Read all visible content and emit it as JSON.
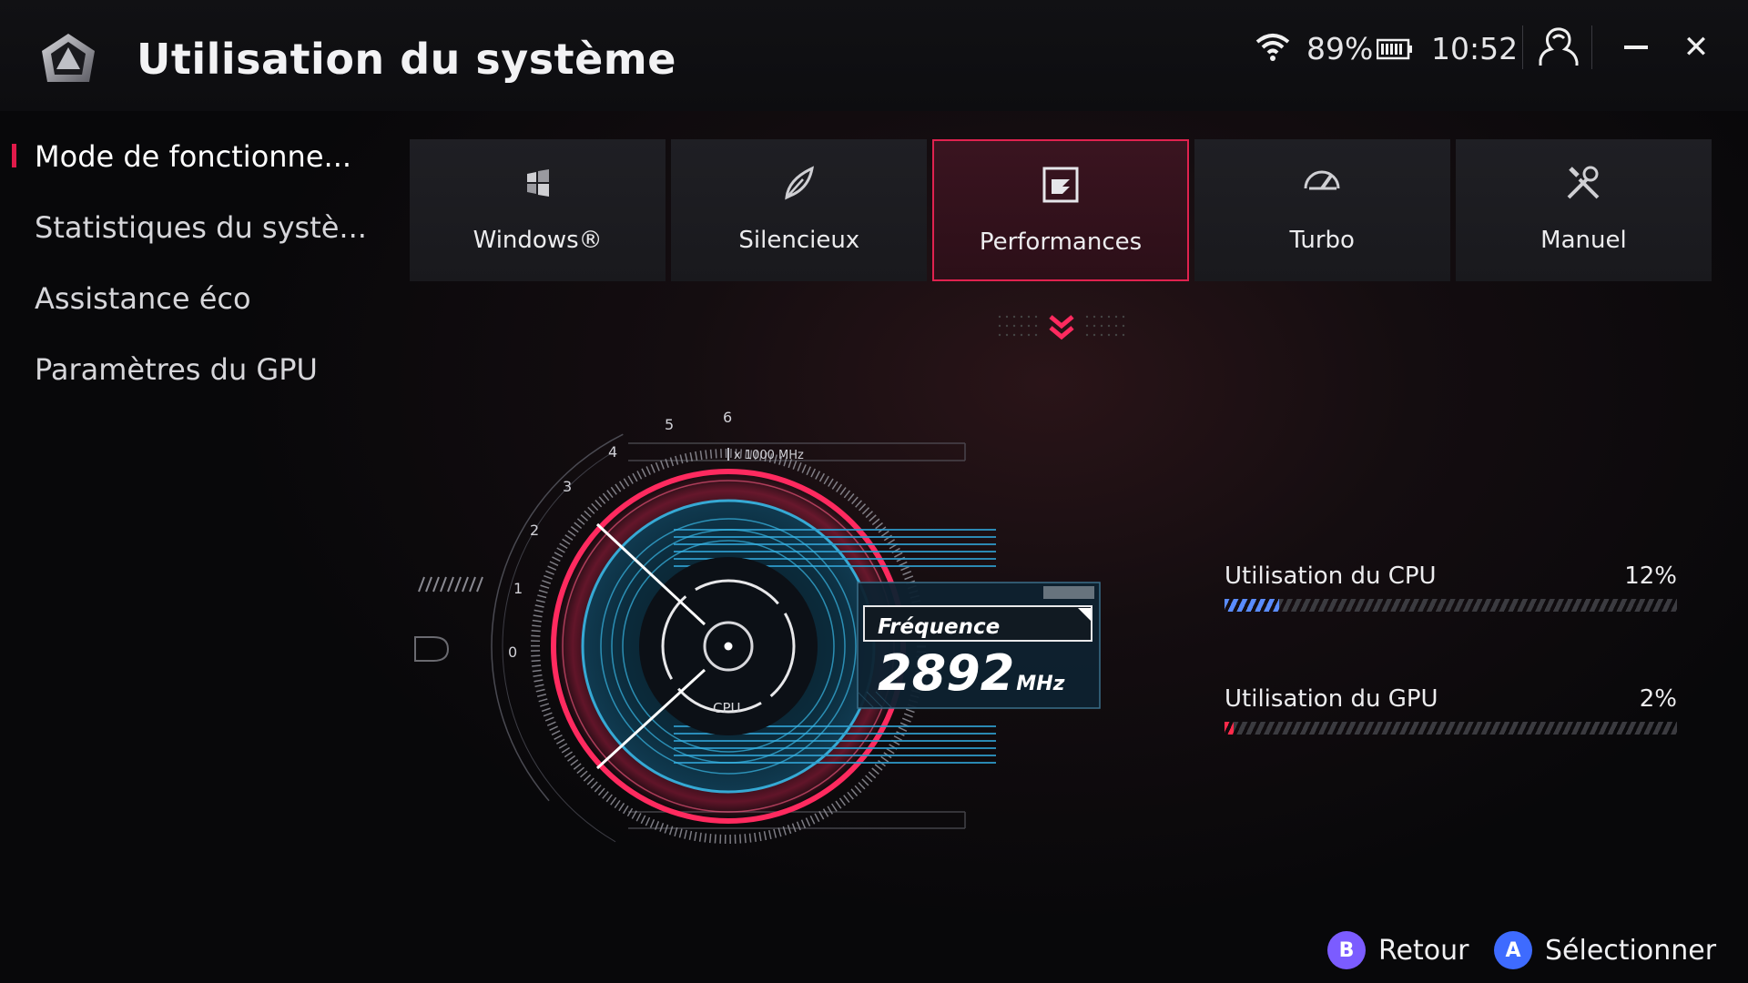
{
  "header": {
    "title": "Utilisation du système",
    "battery_percent": "89%",
    "time": "10:52"
  },
  "sidebar": {
    "items": [
      {
        "label": "Mode de fonctionne...",
        "active": true
      },
      {
        "label": "Statistiques du systè...",
        "active": false
      },
      {
        "label": "Assistance éco",
        "active": false
      },
      {
        "label": "Paramètres du GPU",
        "active": false
      }
    ]
  },
  "modes": [
    {
      "label": "Windows®",
      "icon": "windows-icon",
      "active": false
    },
    {
      "label": "Silencieux",
      "icon": "leaf-icon",
      "active": false
    },
    {
      "label": "Performances",
      "icon": "performance-icon",
      "active": true
    },
    {
      "label": "Turbo",
      "icon": "turbo-icon",
      "active": false
    },
    {
      "label": "Manuel",
      "icon": "tools-icon",
      "active": false
    }
  ],
  "gauge": {
    "scale_label": "x 1000 MHz",
    "ticks": [
      "0",
      "1",
      "2",
      "3",
      "4",
      "5",
      "6"
    ],
    "center_label": "CPU",
    "frequency_title": "Fréquence",
    "frequency_value": "2892",
    "frequency_unit": "MHz",
    "frequency_mhz": 2892
  },
  "usage": {
    "cpu": {
      "label": "Utilisation du CPU",
      "value_text": "12%",
      "fraction": 0.12
    },
    "gpu": {
      "label": "Utilisation du GPU",
      "value_text": "2%",
      "fraction": 0.02
    }
  },
  "footer": {
    "back": {
      "key": "B",
      "label": "Retour"
    },
    "select": {
      "key": "A",
      "label": "Sélectionner"
    }
  },
  "colors": {
    "accent": "#e0224f",
    "gauge_pink": "#ff2a5f",
    "gauge_cyan": "#39b8e6",
    "cpu_bar": "#5a8cff",
    "gpu_bar": "#ff2a4a",
    "back_button": "#7b5cff",
    "select_button": "#3e6bff"
  }
}
